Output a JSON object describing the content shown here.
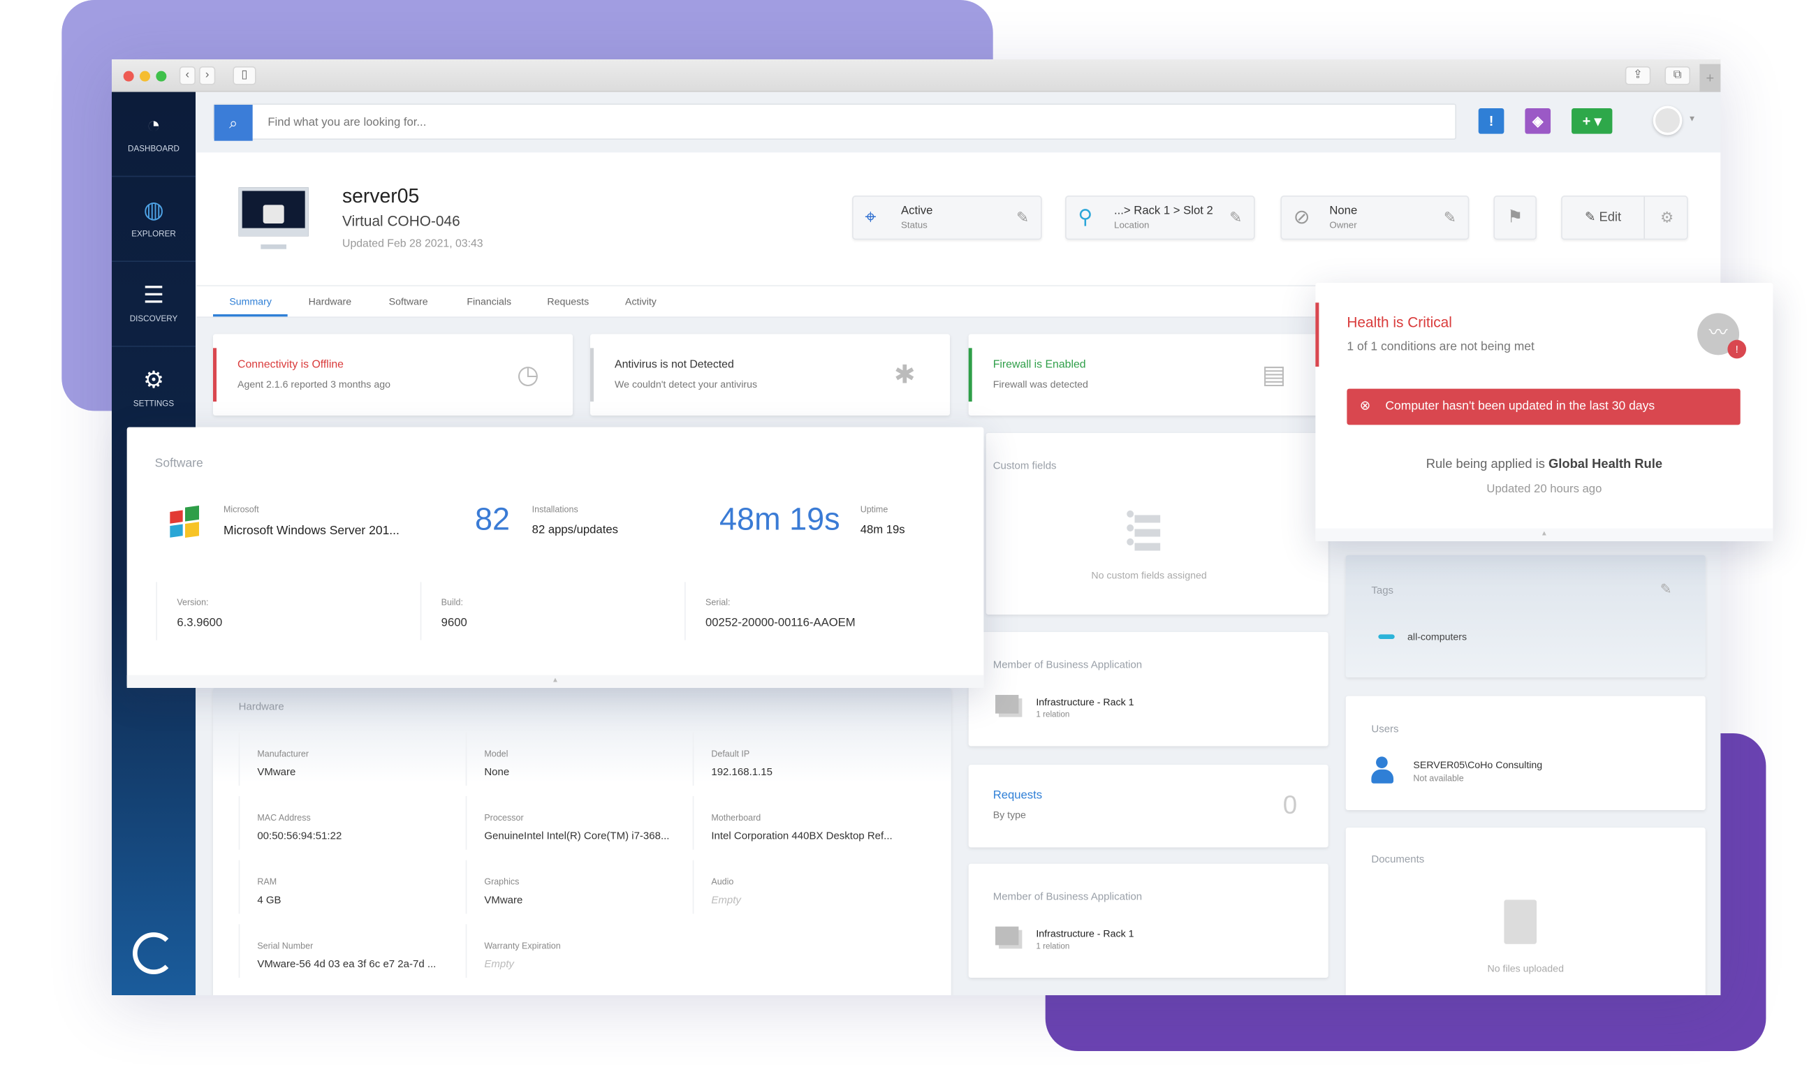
{
  "colors": {
    "accent": "#3b7dd8",
    "danger": "#d9474f",
    "success": "#2e9e48",
    "alert_blue": "#2f7fd6",
    "tag_purple": "#9b59c6",
    "add_green": "#2ea84a",
    "tag_cyan": "#2bb3d9",
    "bg_lavender": "#a19de1",
    "bg_purple": "#6b43b2"
  },
  "window": {
    "back_icon": "chevron-left-icon",
    "forward_icon": "chevron-right-icon",
    "sidebar_icon": "sidebar-toggle-icon",
    "share_icon": "share-icon",
    "tabs_icon": "duplicate-icon",
    "new_tab_icon": "plus-icon"
  },
  "sidebar": {
    "items": [
      {
        "label": "DASHBOARD",
        "icon": "gauge-icon"
      },
      {
        "label": "EXPLORER",
        "icon": "globe-search-icon"
      },
      {
        "label": "DISCOVERY",
        "icon": "checklist-icon"
      },
      {
        "label": "SETTINGS",
        "icon": "gears-icon"
      }
    ],
    "logo": "app-logo-icon"
  },
  "search": {
    "placeholder": "Find what you are looking for..."
  },
  "topbar": {
    "alert_icon": "exclamation-icon",
    "tag_icon": "tag-icon",
    "add_icon": "plus-icon",
    "avatar_icon": "user-avatar-icon"
  },
  "header": {
    "title": "server05",
    "subtitle": "Virtual COHO-046",
    "updated": "Updated Feb 28 2021, 03:43"
  },
  "chips": {
    "status": {
      "value": "Active",
      "label": "Status"
    },
    "location": {
      "value": "...> Rack 1 > Slot 2",
      "label": "Location"
    },
    "owner": {
      "value": "None",
      "label": "Owner"
    },
    "edit_label": "Edit"
  },
  "tabs": [
    "Summary",
    "Hardware",
    "Software",
    "Financials",
    "Requests",
    "Activity"
  ],
  "active_tab": "Summary",
  "status_cards": [
    {
      "title": "Connectivity is Offline",
      "subtitle": "Agent 2.1.6 reported 3 months ago",
      "state": "error"
    },
    {
      "title": "Antivirus is not Detected",
      "subtitle": "We couldn't detect your antivirus",
      "state": "neutral"
    },
    {
      "title": "Firewall is Enabled",
      "subtitle": "Firewall was detected",
      "state": "ok"
    }
  ],
  "health": {
    "title": "Health is Critical",
    "subtitle": "1 of 1 conditions are not being met",
    "alert": "Computer hasn't been updated in the last 30 days",
    "rule_prefix": "Rule being applied is ",
    "rule_name": "Global Health Rule",
    "updated": "Updated 20 hours ago"
  },
  "software": {
    "title": "Software",
    "vendor": "Microsoft",
    "name": "Microsoft Windows Server 201...",
    "installs_count": "82",
    "installs_label": "Installations",
    "installs_value": "82 apps/updates",
    "uptime_big": "48m 19s",
    "uptime_label": "Uptime",
    "uptime_value": "48m 19s",
    "details": [
      {
        "label": "Version:",
        "value": "6.3.9600"
      },
      {
        "label": "Build:",
        "value": "9600"
      },
      {
        "label": "Serial:",
        "value": "00252-20000-00116-AAOEM"
      }
    ]
  },
  "hardware": {
    "title": "Hardware",
    "fields": [
      {
        "label": "Manufacturer",
        "value": "VMware"
      },
      {
        "label": "Model",
        "value": "None"
      },
      {
        "label": "Default IP",
        "value": "192.168.1.15"
      },
      {
        "label": "MAC Address",
        "value": "00:50:56:94:51:22"
      },
      {
        "label": "Processor",
        "value": "GenuineIntel Intel(R) Core(TM) i7-368..."
      },
      {
        "label": "Motherboard",
        "value": "Intel Corporation 440BX Desktop Ref..."
      },
      {
        "label": "RAM",
        "value": "4 GB"
      },
      {
        "label": "Graphics",
        "value": "VMware"
      },
      {
        "label": "Audio",
        "value": "Empty",
        "empty": true
      },
      {
        "label": "Serial Number",
        "value": "VMware-56 4d 03 ea 3f 6c e7 2a-7d ..."
      },
      {
        "label": "Warranty Expiration",
        "value": "Empty",
        "empty": true
      }
    ]
  },
  "custom_fields": {
    "title": "Custom fields",
    "empty": "No custom fields assigned"
  },
  "business_apps": [
    {
      "title": "Member of Business Application",
      "name": "Infrastructure - Rack 1",
      "relation": "1 relation"
    },
    {
      "title": "Member of Business Application",
      "name": "Infrastructure - Rack 1",
      "relation": "1 relation"
    }
  ],
  "requests": {
    "title": "Requests",
    "subtitle": "By type",
    "count": "0"
  },
  "tags": {
    "title": "Tags",
    "items": [
      "all-computers"
    ]
  },
  "users": {
    "title": "Users",
    "name": "SERVER05\\CoHo Consulting",
    "status": "Not available"
  },
  "documents": {
    "title": "Documents",
    "empty": "No files uploaded"
  }
}
